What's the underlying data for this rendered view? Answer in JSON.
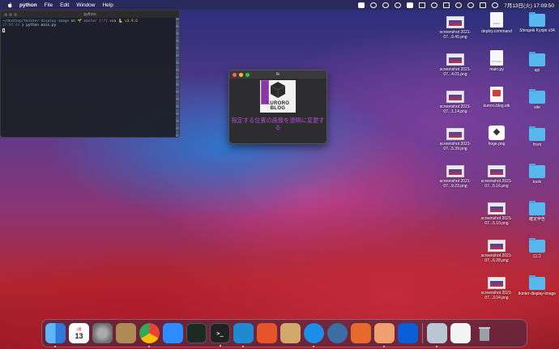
{
  "menubar": {
    "app_name": "python",
    "menus": [
      "File",
      "Edit",
      "Window",
      "Help"
    ],
    "clock": "7月13日(火)  17:09:50"
  },
  "terminal": {
    "title": "python",
    "line1_path": "~/desktop/tkinter-display-image",
    "line1_on": " on ",
    "line1_git": "🌱 master [!?]",
    "line1_via": " via ",
    "line1_ver": "🐍 v3.9.6",
    "line2_time": "17:09:44",
    "line2_prompt": " ❯ python main.py"
  },
  "tk_window": {
    "title": "tk",
    "image_brand": "KURORO BLOG",
    "label": "指定する位置の画像を透明に変更する"
  },
  "desktop_icons": {
    "col1": [
      {
        "label": "screenshot 2021-07...9.45.png"
      },
      {
        "label": "screenshot 2021-07...4.01.png"
      },
      {
        "label": "screenshot 2021-07...1.14.png"
      },
      {
        "label": "screenshot 2021-07...5.39.png"
      },
      {
        "label": "screenshot 2021-07...9.23.png"
      }
    ],
    "col2": [
      {
        "label": "deploy.command",
        "doc_text": "EXEC"
      },
      {
        "label": "main.py",
        "doc_text": "PYTHON"
      },
      {
        "label": "kuroro.blog.stk",
        "doc_text": ""
      },
      {
        "label": "hoge.png",
        "doc_text": ""
      },
      {
        "label": "screenshot 2021-07...5.16.png"
      },
      {
        "label": "screenshot 2021-07...5.10.png"
      },
      {
        "label": "screenshot 2021-07...6.28.png"
      },
      {
        "label": "screenshot 2021-07...3.04.png"
      }
    ],
    "col3": [
      {
        "label": "Shingeki Kyojin v34"
      },
      {
        "label": "api"
      },
      {
        "label": "site"
      },
      {
        "label": "front"
      },
      {
        "label": "tools"
      },
      {
        "label": "確定申告"
      },
      {
        "label": "ロゴ"
      },
      {
        "label": "tkinter-display-image"
      }
    ]
  },
  "dock": {
    "calendar_month": "7月",
    "calendar_day": "13",
    "terminal_glyph": ">_"
  }
}
